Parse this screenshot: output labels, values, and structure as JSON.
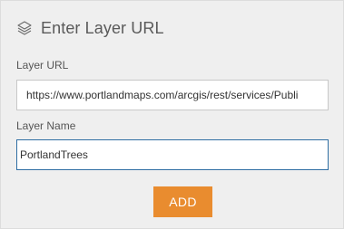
{
  "header": {
    "icon": "layers-icon",
    "title": "Enter Layer URL"
  },
  "form": {
    "url_label": "Layer URL",
    "url_value": "https://www.portlandmaps.com/arcgis/rest/services/Publi",
    "name_label": "Layer Name",
    "name_value": "PortlandTrees",
    "add_label": "ADD"
  },
  "colors": {
    "panel_bg": "#efefef",
    "accent_button": "#e98c2f",
    "focus_border": "#2f6ea3",
    "title_text": "#5a5a5a"
  }
}
